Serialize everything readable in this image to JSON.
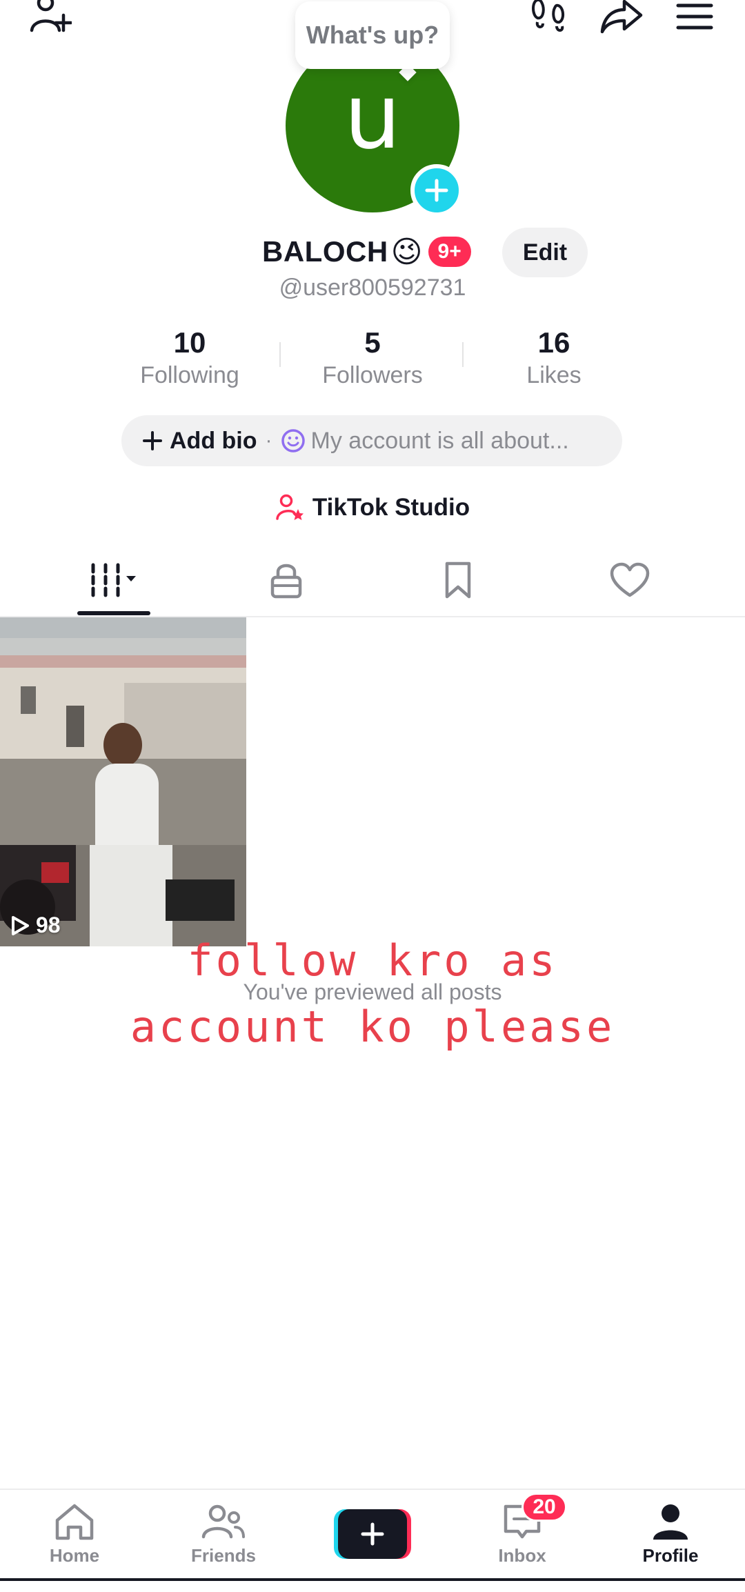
{
  "bubble": {
    "text": "What's up?"
  },
  "avatar": {
    "letter": "u"
  },
  "profile": {
    "name": "BALOCH",
    "emoji": "😉",
    "badge": "9+",
    "edit_label": "Edit",
    "handle": "@user800592731"
  },
  "stats": [
    {
      "value": "10",
      "label": "Following"
    },
    {
      "value": "5",
      "label": "Followers"
    },
    {
      "value": "16",
      "label": "Likes"
    }
  ],
  "bio": {
    "add_label": "Add bio",
    "separator": "·",
    "placeholder": "My account is all about..."
  },
  "studio": {
    "label": "TikTok Studio"
  },
  "tabs": [
    "videos-icon",
    "lock-icon",
    "bookmark-icon",
    "heart-icon"
  ],
  "posts": [
    {
      "views": "98"
    }
  ],
  "overlay_text": {
    "line1": "follow kro as",
    "line2": "account ko please"
  },
  "previewed_text": "You've previewed all posts",
  "nav": {
    "home": "Home",
    "friends": "Friends",
    "inbox": "Inbox",
    "inbox_badge": "20",
    "profile": "Profile"
  },
  "colors": {
    "accent": "#fe2c55",
    "cyan": "#20d5ec",
    "avatar_bg": "#2b7a0b",
    "overlay_text": "#e8414c"
  }
}
